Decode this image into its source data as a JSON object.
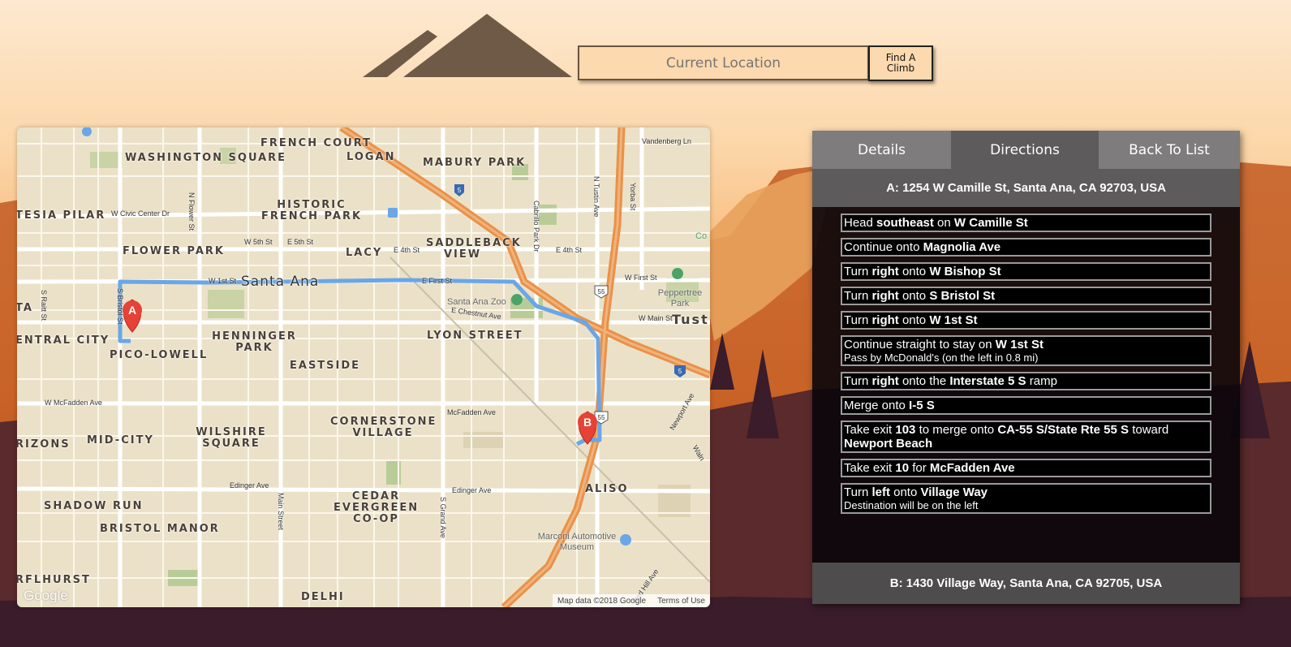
{
  "search": {
    "placeholder": "Current Location",
    "button_label": "Find A Climb"
  },
  "tabs": [
    {
      "label": "Details",
      "active": false
    },
    {
      "label": "Directions",
      "active": true
    },
    {
      "label": "Back To List",
      "active": false
    }
  ],
  "directions": {
    "start_address": "A: 1254 W Camille St, Santa Ana, CA 92703, USA",
    "end_address": "B: 1430 Village Way, Santa Ana, CA 92705, USA",
    "steps": [
      {
        "parts": [
          [
            "Head ",
            false
          ],
          [
            "southeast",
            true
          ],
          [
            " on ",
            false
          ],
          [
            "W Camille St",
            true
          ]
        ]
      },
      {
        "parts": [
          [
            "Continue onto ",
            false
          ],
          [
            "Magnolia Ave",
            true
          ]
        ]
      },
      {
        "parts": [
          [
            "Turn ",
            false
          ],
          [
            "right",
            true
          ],
          [
            " onto ",
            false
          ],
          [
            "W Bishop St",
            true
          ]
        ]
      },
      {
        "parts": [
          [
            "Turn ",
            false
          ],
          [
            "right",
            true
          ],
          [
            " onto ",
            false
          ],
          [
            "S Bristol St",
            true
          ]
        ]
      },
      {
        "parts": [
          [
            "Turn ",
            false
          ],
          [
            "right",
            true
          ],
          [
            " onto ",
            false
          ],
          [
            "W 1st St",
            true
          ]
        ]
      },
      {
        "parts": [
          [
            "Continue straight to stay on ",
            false
          ],
          [
            "W 1st St",
            true
          ]
        ],
        "note": "Pass by McDonald's (on the left in 0.8 mi)"
      },
      {
        "parts": [
          [
            "Turn ",
            false
          ],
          [
            "right",
            true
          ],
          [
            " onto the ",
            false
          ],
          [
            "Interstate 5 S",
            true
          ],
          [
            " ramp",
            false
          ]
        ]
      },
      {
        "parts": [
          [
            "Merge onto ",
            false
          ],
          [
            "I-5 S",
            true
          ]
        ]
      },
      {
        "parts": [
          [
            "Take exit ",
            false
          ],
          [
            "103",
            true
          ],
          [
            " to merge onto ",
            false
          ],
          [
            "CA-55 S/State Rte 55 S",
            true
          ],
          [
            " toward ",
            false
          ],
          [
            "Newport Beach",
            true
          ]
        ]
      },
      {
        "parts": [
          [
            "Take exit ",
            false
          ],
          [
            "10",
            true
          ],
          [
            " for ",
            false
          ],
          [
            "McFadden Ave",
            true
          ]
        ]
      },
      {
        "parts": [
          [
            "Turn ",
            false
          ],
          [
            "left",
            true
          ],
          [
            " onto ",
            false
          ],
          [
            "Village Way",
            true
          ]
        ],
        "note": "Destination will be on the left"
      }
    ]
  },
  "map": {
    "city_label": "Santa Ana",
    "neighborhoods": [
      "WASHINGTON SQUARE",
      "FRENCH COURT",
      "LOGAN",
      "MABURY PARK",
      "HISTORIC FRENCH PARK",
      "TESIA PILAR",
      "FLOWER PARK",
      "LACY",
      "SADDLEBACK VIEW",
      "ENTRAL CITY",
      "PICO-LOWELL",
      "HENNINGER PARK",
      "LYON STREET",
      "EASTSIDE",
      "CORNERSTONE VILLAGE",
      "WILSHIRE SQUARE",
      "MID-CITY",
      "RIZONS",
      "ALISO",
      "SHADOW RUN",
      "CEDAR EVERGREEN CO-OP",
      "BRISTOL MANOR",
      "RFLHURST",
      "DELHI",
      "TA",
      "Tust"
    ],
    "streets": [
      "W Civic Center Dr",
      "N Flower St",
      "W 5th St",
      "E 5th St",
      "E 4th St",
      "E 4th St",
      "W 1st St",
      "E First St",
      "W First St",
      "W Main St",
      "S Raitt St",
      "S Bristol St",
      "W McFadden Ave",
      "McFadden Ave",
      "Edinger Ave",
      "Edinger Ave",
      "Main Street",
      "S Grand Ave",
      "Cabrillo Park Dr",
      "N Tustin Ave",
      "Yorba St",
      "Vandenberg Ln",
      "E Chestnut Ave",
      "Newport Ave",
      "Red Hill Ave",
      "Waln"
    ],
    "pois": [
      "Santa Ana Zoo",
      "Peppertree Park",
      "Marconi Automotive Museum",
      "Co"
    ],
    "marker_a": "A",
    "marker_b": "B",
    "highway_labels": [
      "5",
      "55",
      "55",
      "5"
    ],
    "attribution": "Map data ©2018 Google",
    "terms": "Terms of Use",
    "logo": "Google"
  },
  "colors": {
    "route": "#6aa6e8",
    "freeway": "#e8924a",
    "marker": "#e64235",
    "panel_tab": "#7e7c7c",
    "panel_tab_active": "#5d5b5b"
  }
}
